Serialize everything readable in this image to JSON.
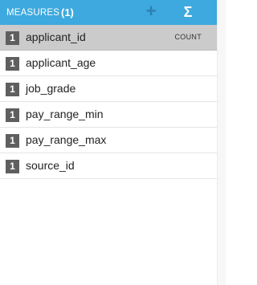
{
  "header": {
    "title": "MEASURES",
    "count": "(1)",
    "add_icon": "+",
    "sigma_icon": "Σ"
  },
  "measures": [
    {
      "badge": "1",
      "label": "applicant_id",
      "aggregation": "COUNT",
      "selected": true
    },
    {
      "badge": "1",
      "label": "applicant_age",
      "aggregation": "",
      "selected": false
    },
    {
      "badge": "1",
      "label": "job_grade",
      "aggregation": "",
      "selected": false
    },
    {
      "badge": "1",
      "label": "pay_range_min",
      "aggregation": "",
      "selected": false
    },
    {
      "badge": "1",
      "label": "pay_range_max",
      "aggregation": "",
      "selected": false
    },
    {
      "badge": "1",
      "label": "source_id",
      "aggregation": "",
      "selected": false
    }
  ],
  "colors": {
    "header_bg": "#3da9de",
    "selected_row_bg": "#cbcbcb",
    "badge_bg": "#5f5f5f"
  }
}
